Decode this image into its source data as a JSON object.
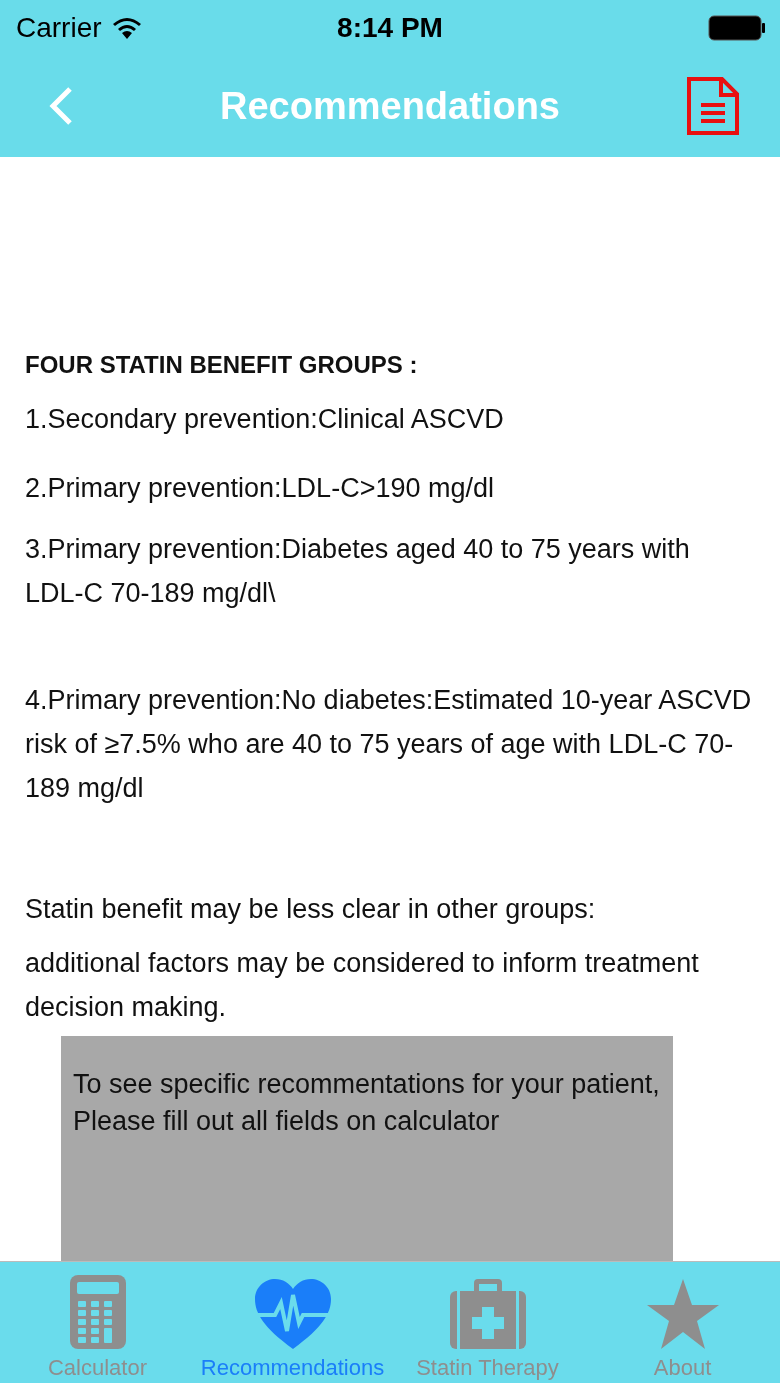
{
  "status_bar": {
    "carrier": "Carrier",
    "time": "8:14 PM"
  },
  "nav_bar": {
    "title": "Recommendations"
  },
  "content": {
    "heading": "FOUR STATIN BENEFIT GROUPS :",
    "paragraphs": [
      "1.Secondary prevention:Clinical ASCVD",
      "2.Primary prevention:LDL-C>190 mg/dl",
      "3.Primary prevention:Diabetes aged 40 to 75 years with LDL-C 70-189 mg/dl\\",
      "4.Primary prevention:No diabetes:Estimated 10-year ASCVD risk of ≥7.5% who are 40 to 75 years of age with LDL-C 70-189 mg/dl",
      "Statin benefit may be less clear in other groups:",
      "additional factors may be considered to inform treatment decision making."
    ],
    "notice": "To see specific recommentations for your patient, Please fill out all fields on calculator"
  },
  "tab_bar": [
    {
      "kind": "calculator",
      "label": "Calculator",
      "selected": false
    },
    {
      "kind": "heart",
      "label": "Recommendations",
      "selected": true
    },
    {
      "kind": "kit",
      "label": "Statin Therapy",
      "selected": false
    },
    {
      "kind": "star",
      "label": "About",
      "selected": false
    }
  ]
}
